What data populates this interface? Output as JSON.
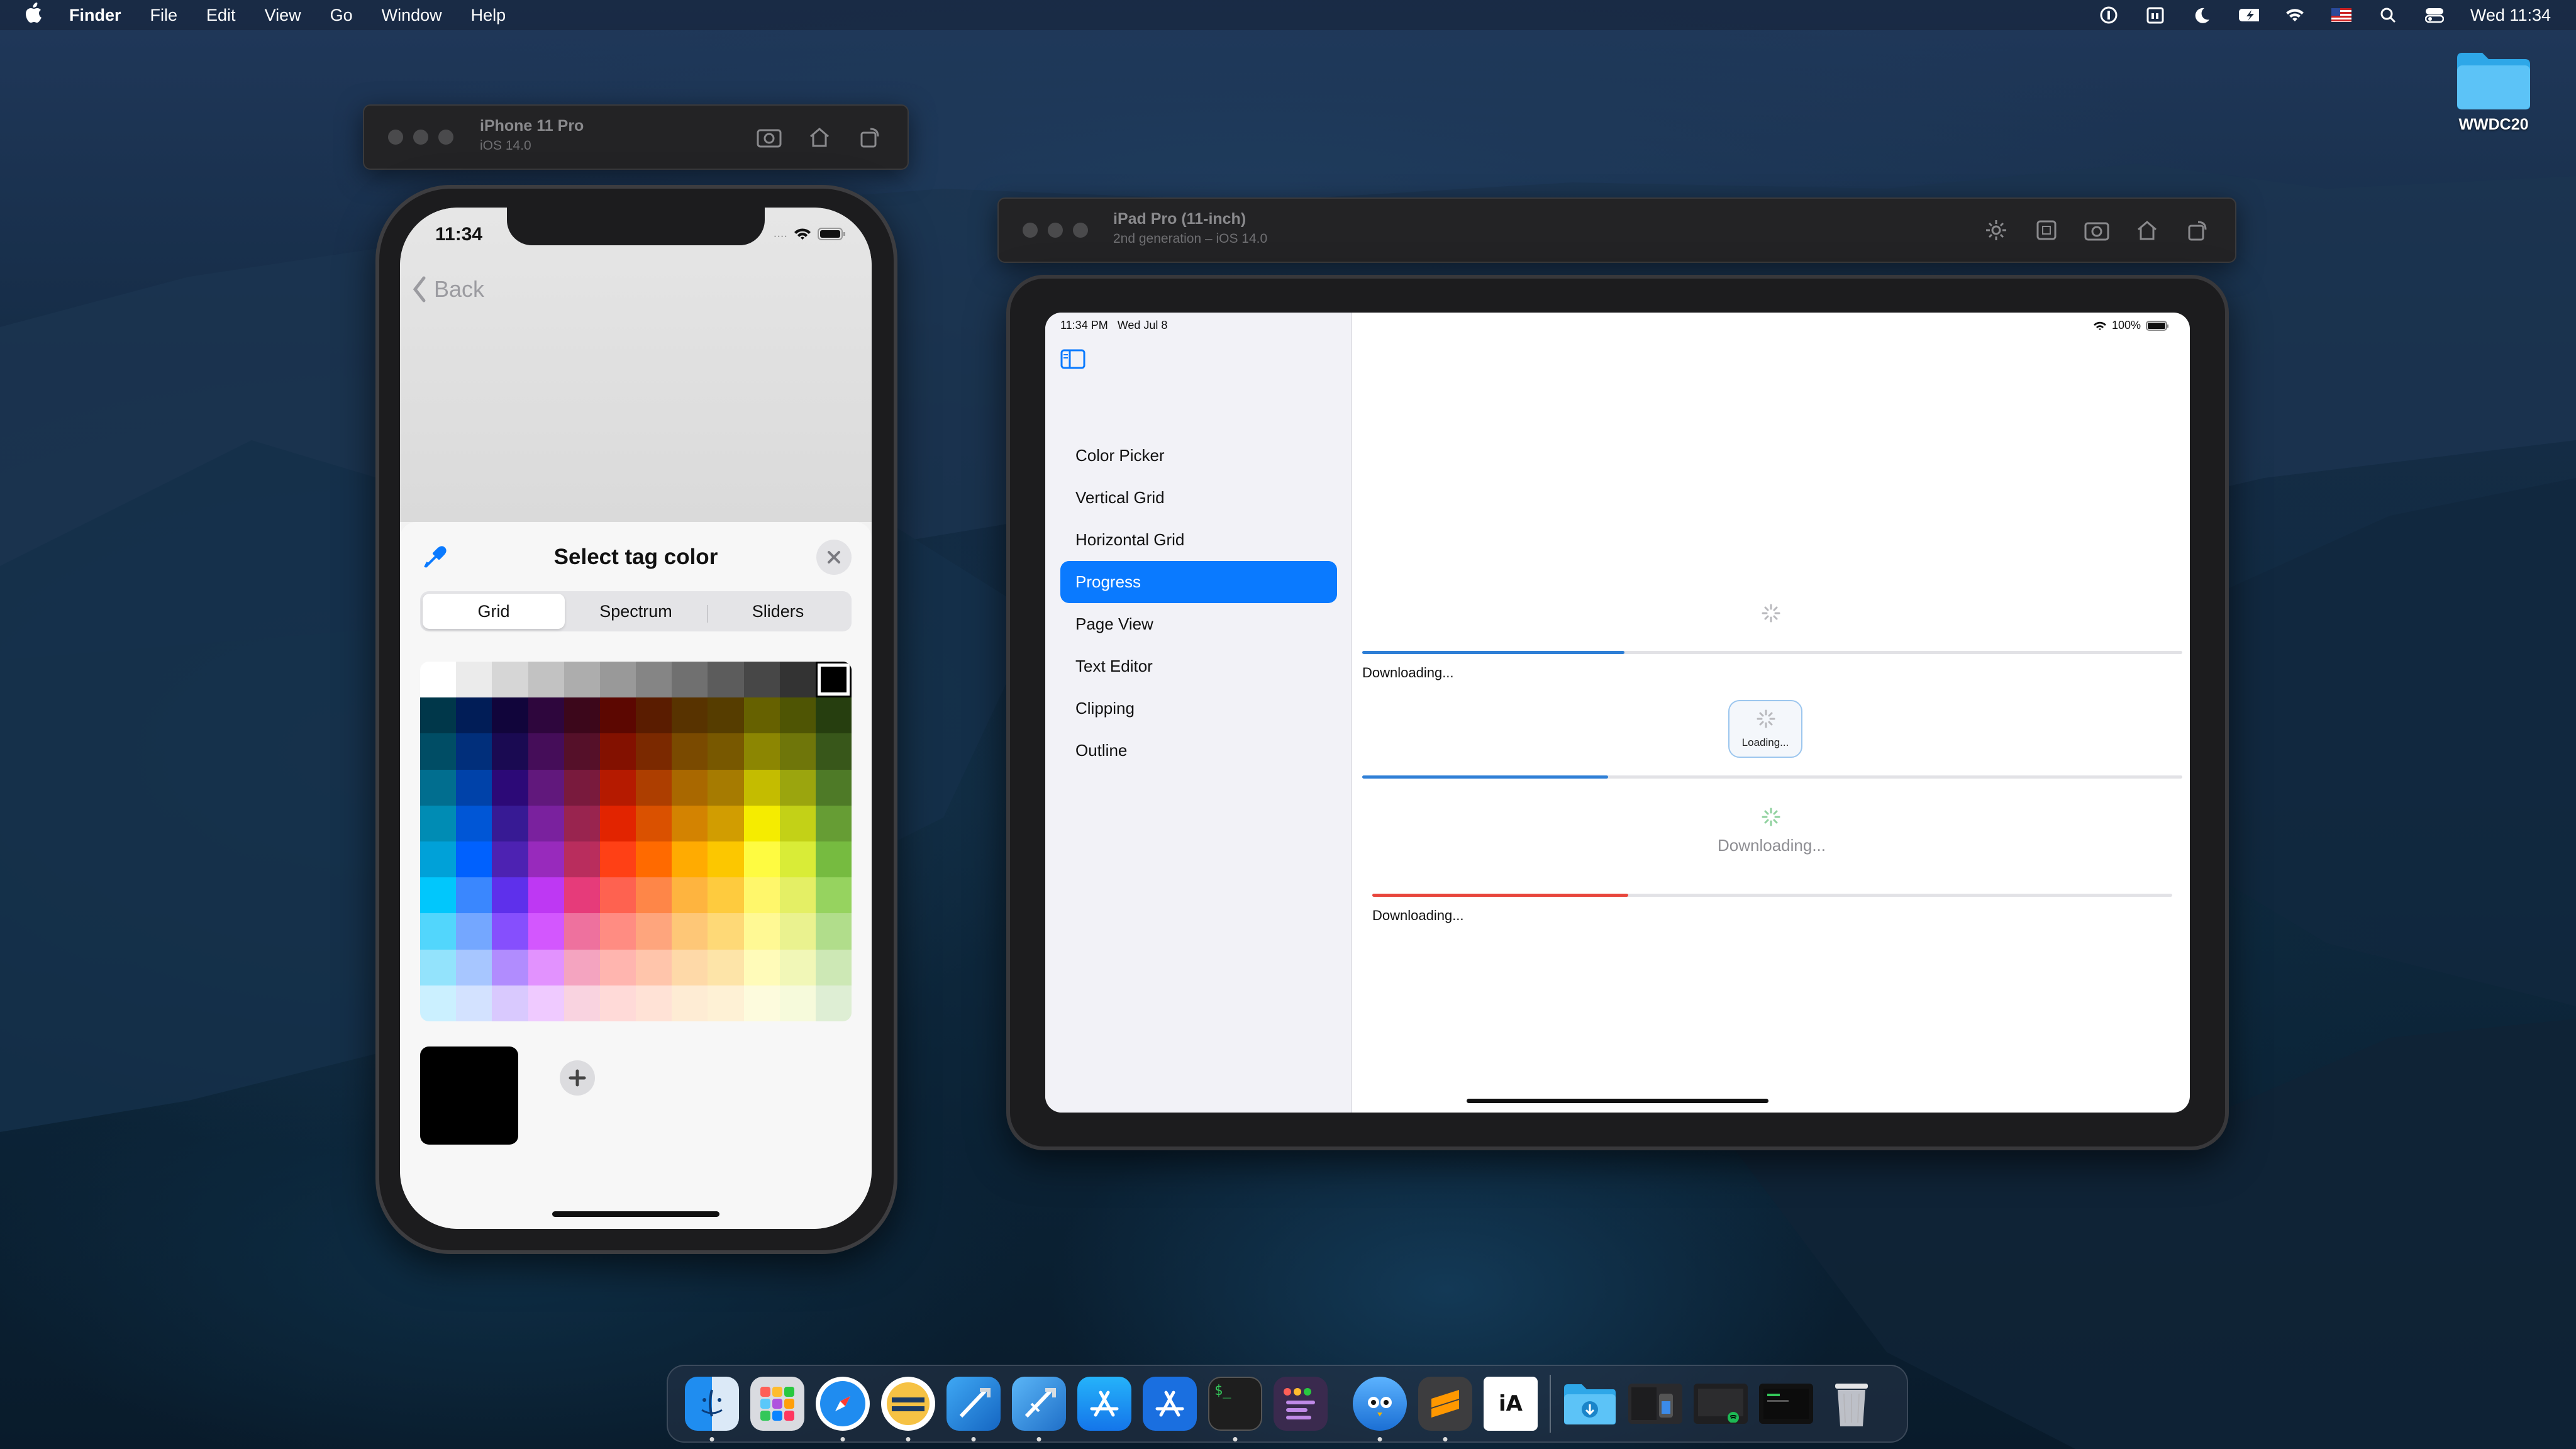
{
  "menubar": {
    "app_name": "Finder",
    "menus": [
      "File",
      "Edit",
      "View",
      "Go",
      "Window",
      "Help"
    ],
    "clock": "Wed 11:34",
    "status_icons": [
      "onepassword-icon",
      "fantastical-icon",
      "moon-icon",
      "battery-icon",
      "wifi-icon",
      "flag-icon",
      "spotlight-icon",
      "control-center-icon"
    ]
  },
  "desktop": {
    "folder_label": "WWDC20"
  },
  "iphone_simulator": {
    "title": "iPhone 11 Pro",
    "subtitle": "iOS 14.0",
    "status_time": "11:34",
    "back_label": "Back",
    "sheet_title": "Select tag color",
    "segments": [
      "Grid",
      "Spectrum",
      "Sliders"
    ],
    "active_segment": "Grid",
    "selected_color": "#000000",
    "color_grid": [
      [
        "#ffffff",
        "#ebebeb",
        "#d6d6d6",
        "#c2c2c2",
        "#adadad",
        "#999999",
        "#858585",
        "#707070",
        "#5c5c5c",
        "#474747",
        "#333333",
        "#000000"
      ],
      [
        "#00374a",
        "#011d57",
        "#11053b",
        "#2e063d",
        "#3c071b",
        "#5c0701",
        "#5a1c00",
        "#583300",
        "#563d00",
        "#666100",
        "#4f5504",
        "#263e0f"
      ],
      [
        "#004d65",
        "#012f7b",
        "#1a0a52",
        "#450d59",
        "#551029",
        "#831100",
        "#7b2900",
        "#7a4a00",
        "#785800",
        "#8c8602",
        "#6f760a",
        "#38571a"
      ],
      [
        "#016e8f",
        "#0042a9",
        "#2c0977",
        "#61187c",
        "#791a3d",
        "#b51a00",
        "#ad3e00",
        "#a96800",
        "#a67b01",
        "#c4bc00",
        "#9ba50e",
        "#4e7a27"
      ],
      [
        "#008cb4",
        "#0056d6",
        "#371a94",
        "#7a219e",
        "#99244f",
        "#e22400",
        "#da5100",
        "#d38301",
        "#d19d01",
        "#f5ec00",
        "#c3d117",
        "#669d34"
      ],
      [
        "#00a1d8",
        "#0061fe",
        "#4d22b2",
        "#982abc",
        "#b92d5d",
        "#ff4015",
        "#ff6a00",
        "#ffab01",
        "#fcc700",
        "#fefb41",
        "#d9ec37",
        "#76bb40"
      ],
      [
        "#01c7fc",
        "#3a87fe",
        "#5e30eb",
        "#be38f3",
        "#e63b7a",
        "#fe6250",
        "#fe8648",
        "#feb43f",
        "#fecb3e",
        "#fff76b",
        "#e4ef65",
        "#96d35f"
      ],
      [
        "#52d6fc",
        "#74a7ff",
        "#864ffd",
        "#d357fe",
        "#ee719e",
        "#ff8c82",
        "#fea57d",
        "#fec777",
        "#fed977",
        "#fff994",
        "#eaf28f",
        "#b1dd8b"
      ],
      [
        "#93e3fc",
        "#a7c6ff",
        "#b18cfe",
        "#e292fe",
        "#f4a4c0",
        "#ffb5af",
        "#ffc5ab",
        "#fed9a8",
        "#fde4a8",
        "#fffbb9",
        "#f1f7b7",
        "#cde8b5"
      ],
      [
        "#cbf0ff",
        "#d3e2ff",
        "#d9c9fe",
        "#efcaff",
        "#f9d3e0",
        "#ffdad8",
        "#ffe2d6",
        "#feecd4",
        "#fef1d5",
        "#fdfbdd",
        "#f6fadb",
        "#deeed4"
      ]
    ]
  },
  "ipad_simulator": {
    "title": "iPad Pro (11-inch)",
    "subtitle": "2nd generation – iOS 14.0",
    "status_left": "11:34 PM   Wed Jul 8",
    "battery": "100%",
    "nav_items": [
      "Color Picker",
      "Vertical Grid",
      "Horizontal Grid",
      "Progress",
      "Page View",
      "Text Editor",
      "Clipping",
      "Outline"
    ],
    "active_nav": "Progress",
    "progress": {
      "bar1_label": "Downloading...",
      "bar1_value": 0.32,
      "loading_label": "Loading...",
      "bar2_value": 0.3,
      "custom_label": "Downloading...",
      "bar3_label": "Downloading...",
      "bar3_value": 0.32
    },
    "accent_color": "#0a7aff",
    "red_color": "#e8453c"
  },
  "dock": {
    "apps": [
      "finder-icon",
      "launchpad-icon",
      "safari-icon",
      "app-icon",
      "xcode-icon",
      "xcode-beta-icon",
      "app-store-icon",
      "app-store-beta-icon",
      "terminal-icon",
      "app-icon",
      "tweetbot-icon",
      "sublime-icon",
      "ia-writer-icon",
      "downloads-folder-icon",
      "window-thumbnail",
      "window-thumbnail",
      "window-thumbnail",
      "trash-icon"
    ],
    "terminal_text": "$_",
    "ia_text": "iA"
  }
}
